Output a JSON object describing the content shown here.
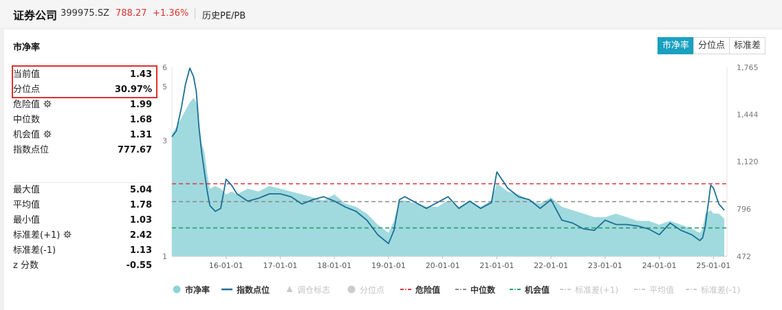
{
  "header": {
    "name": "证券公司",
    "code": "399975.SZ",
    "price": "788.27",
    "change": "+1.36%",
    "page": "历史PE/PB"
  },
  "panel": {
    "title": "市净率"
  },
  "tabs": [
    {
      "label": "市净率",
      "active": true
    },
    {
      "label": "分位点",
      "active": false
    },
    {
      "label": "标准差",
      "active": false
    }
  ],
  "stats_top": [
    {
      "label": "当前值",
      "value": "1.43",
      "gear": false
    },
    {
      "label": "分位点",
      "value": "30.97%",
      "gear": false
    },
    {
      "label": "危险值",
      "value": "1.99",
      "gear": true
    },
    {
      "label": "中位数",
      "value": "1.68",
      "gear": false
    },
    {
      "label": "机会值",
      "value": "1.31",
      "gear": true
    },
    {
      "label": "指数点位",
      "value": "777.67",
      "gear": false
    }
  ],
  "stats_bottom": [
    {
      "label": "最大值",
      "value": "5.04",
      "gear": false
    },
    {
      "label": "平均值",
      "value": "1.78",
      "gear": false
    },
    {
      "label": "最小值",
      "value": "1.03",
      "gear": false
    },
    {
      "label": "标准差(+1)",
      "value": "2.42",
      "gear": true
    },
    {
      "label": "标准差(-1)",
      "value": "1.13",
      "gear": false
    },
    {
      "label": "z 分数",
      "value": "-0.55",
      "gear": false
    }
  ],
  "colors": {
    "area": "#8fd3d8",
    "index_line": "#1c6e94",
    "danger": "#d9363e",
    "median": "#888888",
    "opportunity": "#1fa06a",
    "accent": "#1aa0c0"
  },
  "chart_data": {
    "type": "area",
    "x_ticks": [
      "16-01-01",
      "17-01-01",
      "18-01-01",
      "19-01-01",
      "20-01-01",
      "21-01-01",
      "22-01-01",
      "23-01-01",
      "24-01-01",
      "25-01-01"
    ],
    "x_range": [
      2015.0,
      2025.25
    ],
    "left_axis": {
      "ticks": [
        "6",
        "5",
        "3",
        "1"
      ],
      "tick_values": [
        6,
        5,
        3,
        1
      ],
      "range": [
        1,
        6
      ],
      "scale": "log"
    },
    "right_axis": {
      "ticks": [
        "1,765",
        "1,444",
        "1,120",
        "796",
        "472"
      ],
      "range": [
        472,
        1765
      ]
    },
    "series": [
      {
        "name": "市净率",
        "kind": "area",
        "axis": "left",
        "x": [
          2015.0,
          2015.08,
          2015.17,
          2015.25,
          2015.33,
          2015.4,
          2015.45,
          2015.5,
          2015.55,
          2015.6,
          2015.65,
          2015.7,
          2015.8,
          2015.9,
          2016.0,
          2016.1,
          2016.2,
          2016.4,
          2016.6,
          2016.8,
          2017.0,
          2017.2,
          2017.4,
          2017.6,
          2017.8,
          2018.0,
          2018.2,
          2018.4,
          2018.6,
          2018.8,
          2019.0,
          2019.1,
          2019.2,
          2019.3,
          2019.5,
          2019.7,
          2019.9,
          2020.1,
          2020.3,
          2020.5,
          2020.7,
          2020.9,
          2021.0,
          2021.2,
          2021.4,
          2021.6,
          2021.8,
          2022.0,
          2022.2,
          2022.4,
          2022.6,
          2022.8,
          2023.0,
          2023.2,
          2023.4,
          2023.6,
          2023.8,
          2024.0,
          2024.2,
          2024.4,
          2024.6,
          2024.75,
          2024.8,
          2024.85,
          2024.95,
          2025.0,
          2025.1,
          2025.2
        ],
        "values": [
          3.2,
          3.4,
          3.7,
          4.0,
          4.3,
          4.5,
          4.3,
          3.6,
          2.9,
          2.7,
          2.2,
          1.9,
          1.95,
          1.9,
          1.8,
          1.85,
          1.8,
          1.9,
          1.85,
          1.95,
          1.9,
          1.85,
          1.8,
          1.75,
          1.7,
          1.8,
          1.65,
          1.6,
          1.5,
          1.35,
          1.25,
          1.4,
          1.7,
          1.7,
          1.65,
          1.6,
          1.6,
          1.7,
          1.6,
          1.7,
          1.6,
          1.7,
          2.0,
          1.85,
          1.8,
          1.7,
          1.65,
          1.75,
          1.6,
          1.55,
          1.5,
          1.45,
          1.45,
          1.5,
          1.45,
          1.4,
          1.4,
          1.35,
          1.4,
          1.35,
          1.3,
          1.25,
          1.3,
          1.5,
          1.55,
          1.5,
          1.5,
          1.43
        ]
      },
      {
        "name": "指数点位",
        "kind": "line",
        "axis": "right",
        "x": [
          2015.0,
          2015.08,
          2015.17,
          2015.25,
          2015.33,
          2015.4,
          2015.45,
          2015.5,
          2015.55,
          2015.6,
          2015.65,
          2015.7,
          2015.8,
          2015.9,
          2016.0,
          2016.1,
          2016.2,
          2016.4,
          2016.6,
          2016.8,
          2017.0,
          2017.2,
          2017.4,
          2017.6,
          2017.8,
          2018.0,
          2018.2,
          2018.4,
          2018.6,
          2018.8,
          2019.0,
          2019.1,
          2019.2,
          2019.3,
          2019.5,
          2019.7,
          2019.9,
          2020.1,
          2020.3,
          2020.5,
          2020.7,
          2020.9,
          2021.0,
          2021.2,
          2021.4,
          2021.6,
          2021.8,
          2022.0,
          2022.2,
          2022.4,
          2022.6,
          2022.8,
          2023.0,
          2023.2,
          2023.4,
          2023.6,
          2023.8,
          2024.0,
          2024.2,
          2024.4,
          2024.6,
          2024.75,
          2024.8,
          2024.85,
          2024.95,
          2025.0,
          2025.1,
          2025.2
        ],
        "values": [
          1290,
          1330,
          1480,
          1650,
          1760,
          1700,
          1600,
          1350,
          1180,
          1050,
          920,
          820,
          780,
          800,
          1000,
          960,
          900,
          850,
          870,
          900,
          900,
          880,
          830,
          860,
          880,
          850,
          810,
          780,
          720,
          620,
          560,
          650,
          860,
          880,
          840,
          800,
          840,
          880,
          800,
          850,
          800,
          840,
          1050,
          940,
          880,
          860,
          800,
          860,
          720,
          700,
          660,
          650,
          720,
          690,
          690,
          680,
          660,
          620,
          700,
          650,
          620,
          580,
          600,
          680,
          960,
          940,
          830,
          788
        ]
      }
    ],
    "reference_lines": [
      {
        "name": "危险值",
        "value": 1.99,
        "axis": "left"
      },
      {
        "name": "中位数",
        "value": 1.68,
        "axis": "left"
      },
      {
        "name": "机会值",
        "value": 1.31,
        "axis": "left"
      }
    ],
    "legend": [
      {
        "label": "市净率",
        "enabled": true,
        "marker": "circle"
      },
      {
        "label": "指数点位",
        "enabled": true,
        "marker": "line"
      },
      {
        "label": "调仓标志",
        "enabled": false,
        "marker": "triangle"
      },
      {
        "label": "分位点",
        "enabled": false,
        "marker": "circle"
      },
      {
        "label": "危险值",
        "enabled": true,
        "marker": "dash-red"
      },
      {
        "label": "中位数",
        "enabled": true,
        "marker": "dash-gray"
      },
      {
        "label": "机会值",
        "enabled": true,
        "marker": "dash-green"
      },
      {
        "label": "标准差(+1)",
        "enabled": false,
        "marker": "dash"
      },
      {
        "label": "平均值",
        "enabled": false,
        "marker": "dash"
      },
      {
        "label": "标准差(-1)",
        "enabled": false,
        "marker": "dash"
      }
    ],
    "legend_position": "bottom",
    "grid": false
  }
}
